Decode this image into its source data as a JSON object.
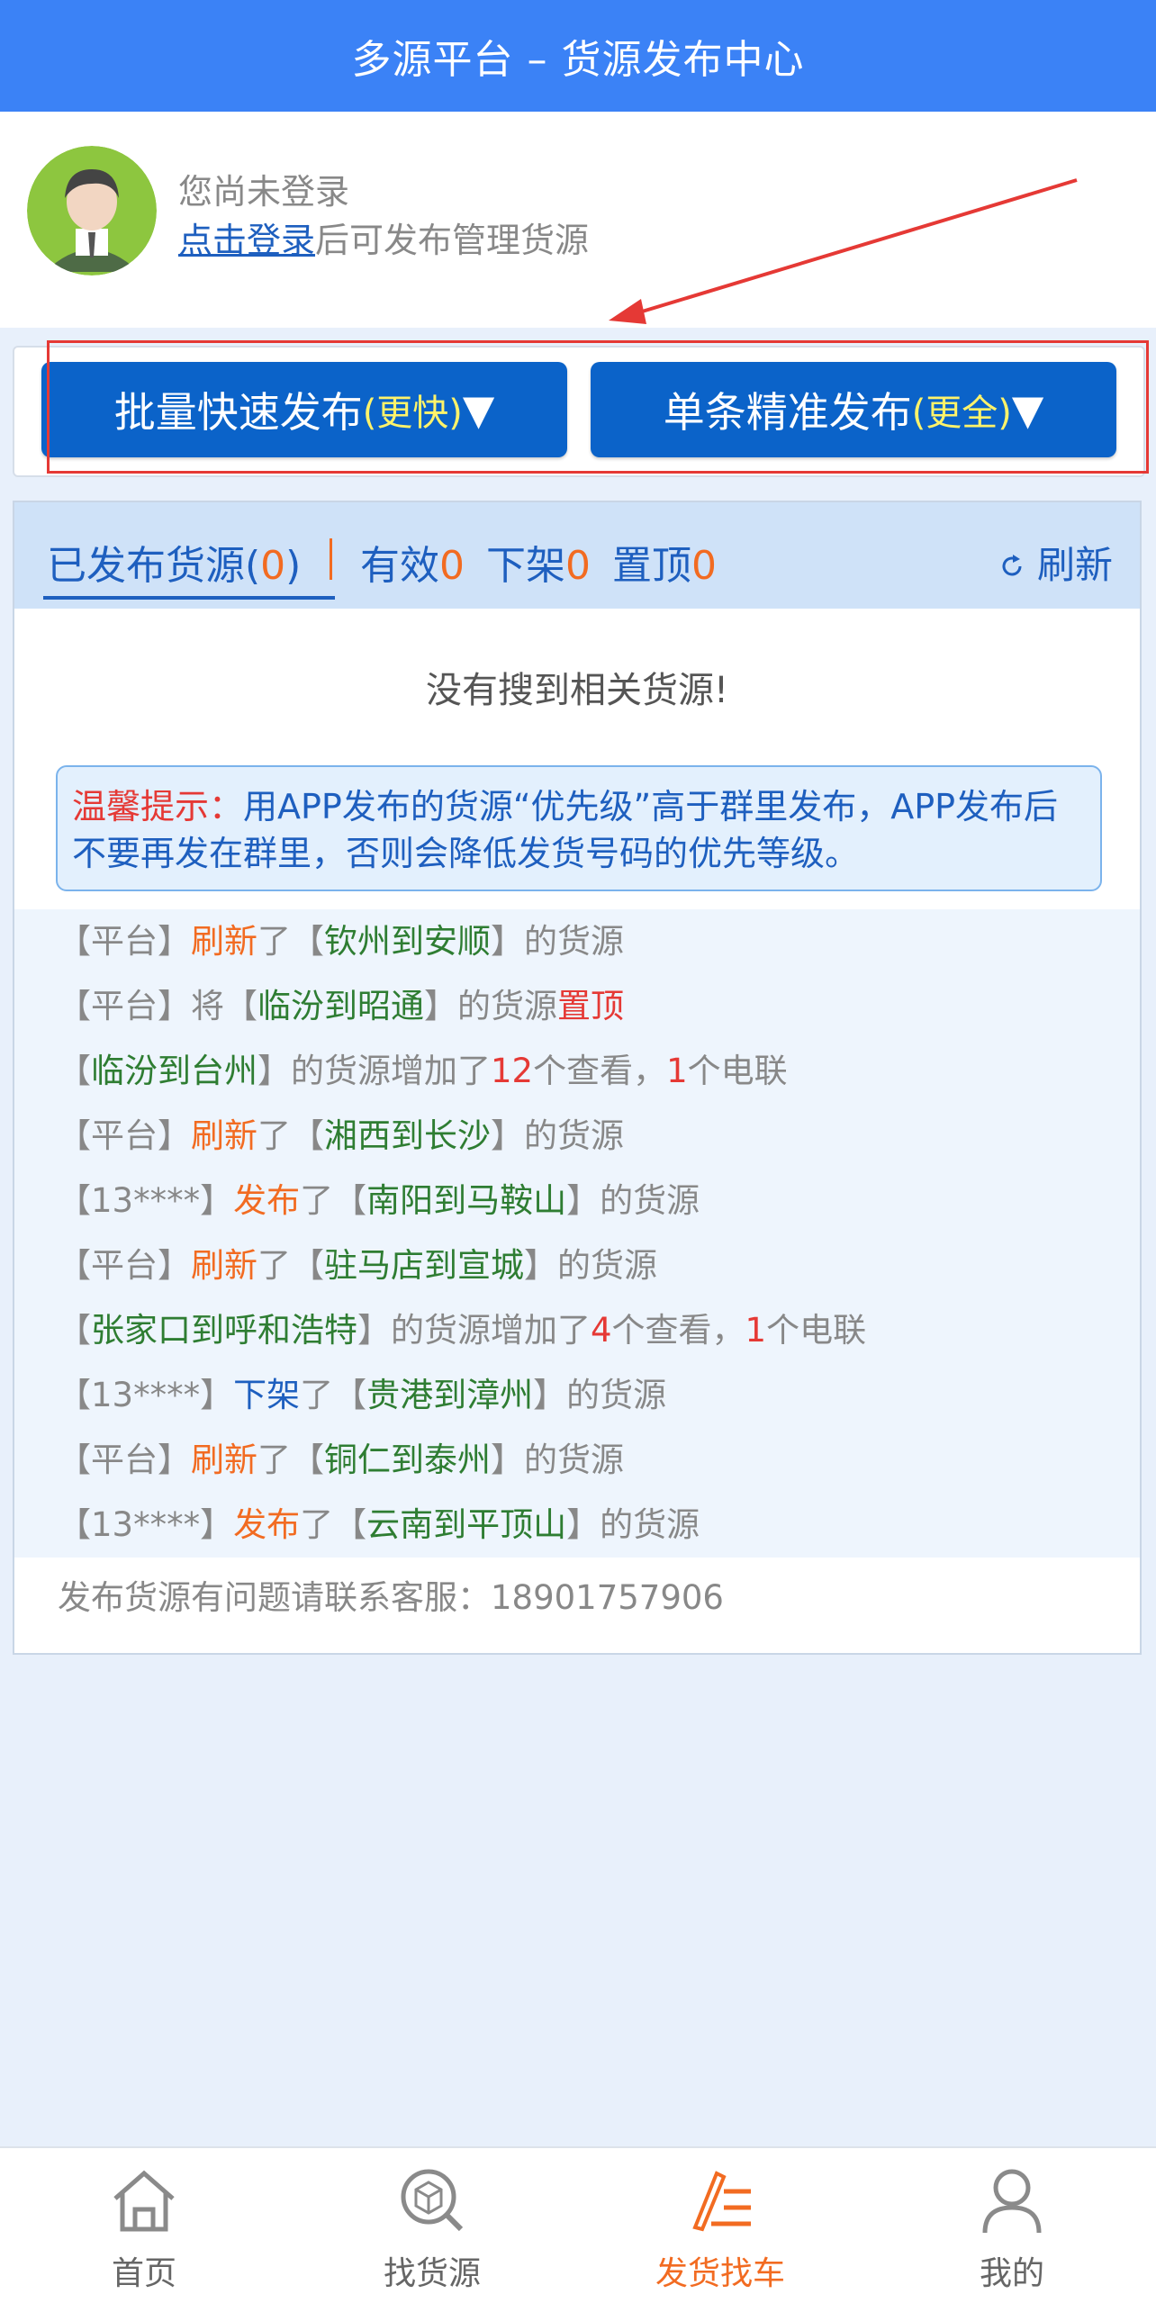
{
  "header": {
    "title": "多源平台 – 货源发布中心"
  },
  "user": {
    "status": "您尚未登录",
    "login_link": "点击登录",
    "login_suffix": "后可发布管理货源"
  },
  "publish": {
    "batch": {
      "label": "批量快速发布",
      "hint": "(更快)",
      "arrow": "▼"
    },
    "single": {
      "label": "单条精准发布",
      "hint": "(更全)",
      "arrow": "▼"
    }
  },
  "tabs": {
    "published": {
      "label": "已发布货源(",
      "count": "0",
      "close": ")"
    },
    "valid": {
      "label": "有效",
      "count": "0"
    },
    "offline": {
      "label": "下架",
      "count": "0"
    },
    "top": {
      "label": "置顶",
      "count": "0"
    },
    "refresh": "刷新"
  },
  "empty_message": "没有搜到相关货源!",
  "tip": {
    "label": "温馨提示：",
    "text": "用APP发布的货源“优先级”高于群里发布，APP发布后不要再发在群里，否则会降低发货号码的优先等级。"
  },
  "feed": [
    {
      "pre": "【平台】",
      "act": "刷新",
      "mid": "了【",
      "route": "钦州到安顺",
      "post": "】的货源"
    },
    {
      "pre": "【平台】将【",
      "route": "临汾到昭通",
      "post": "】的货源",
      "red": "置顶"
    },
    {
      "pre": "【",
      "route": "临汾到台州",
      "post": "】的货源增加了",
      "red": "12",
      "post2": "个查看，",
      "red2": "1",
      "post3": "个电联"
    },
    {
      "pre": "【平台】",
      "act": "刷新",
      "mid": "了【",
      "route": "湘西到长沙",
      "post": "】的货源"
    },
    {
      "pre": "【13****】",
      "act": "发布",
      "mid": "了【",
      "route": "南阳到马鞍山",
      "post": "】的货源"
    },
    {
      "pre": "【平台】",
      "act": "刷新",
      "mid": "了【",
      "route": "驻马店到宣城",
      "post": "】的货源"
    },
    {
      "pre": "【",
      "route": "张家口到呼和浩特",
      "post": "】的货源增加了",
      "red": "4",
      "post2": "个查看，",
      "red2": "1",
      "post3": "个电联"
    },
    {
      "pre": "【13****】",
      "blue": "下架",
      "mid": "了【",
      "route": "贵港到漳州",
      "post": "】的货源"
    },
    {
      "pre": "【平台】",
      "act": "刷新",
      "mid": "了【",
      "route": "铜仁到泰州",
      "post": "】的货源"
    },
    {
      "pre": "【13****】",
      "act": "发布",
      "mid": "了【",
      "route": "云南到平顶山",
      "post": "】的货源"
    }
  ],
  "contact": "发布货源有问题请联系客服：18901757906",
  "nav": {
    "home": "首页",
    "find_goods": "找货源",
    "ship": "发货找车",
    "mine": "我的"
  },
  "colors": {
    "header": "#3b82f6",
    "button": "#0b63c9",
    "accent": "#f26b21",
    "route": "#2e7d32"
  },
  "icons": [
    "user-avatar-icon",
    "refresh-icon",
    "home-icon",
    "find-goods-icon",
    "ship-icon",
    "mine-icon"
  ]
}
